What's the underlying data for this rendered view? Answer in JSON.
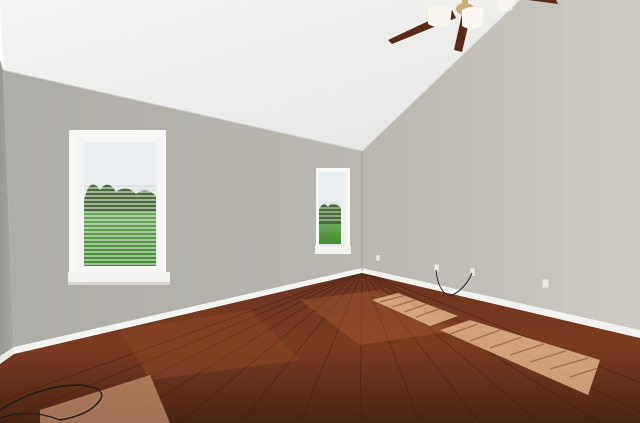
{
  "scene": {
    "description_visible_text": [],
    "colors": {
      "ceiling": "#f2f2f1",
      "ceiling_shadow": "#d9d9d8",
      "wall_left": "#a9a8a3",
      "wall_back": "#b7b5ae",
      "wall_right": "#c3c1ba",
      "baseboard": "#f4f4f2",
      "floor_dark": "#4a2414",
      "floor_mid": "#7a3a1e",
      "floor_light": "#b4643a",
      "window_frame": "#f7f7f5",
      "blind": "#eef0ee",
      "lawn": "#4f9a3a",
      "sky": "#e8eef2",
      "fan_blade": "#5a2a18",
      "fan_metal": "#c9b07a",
      "outlet": "#ece9e2",
      "cable": "#1c1c1c"
    },
    "icons": [
      "ceiling-fan",
      "window",
      "power-outlet",
      "cable"
    ]
  }
}
